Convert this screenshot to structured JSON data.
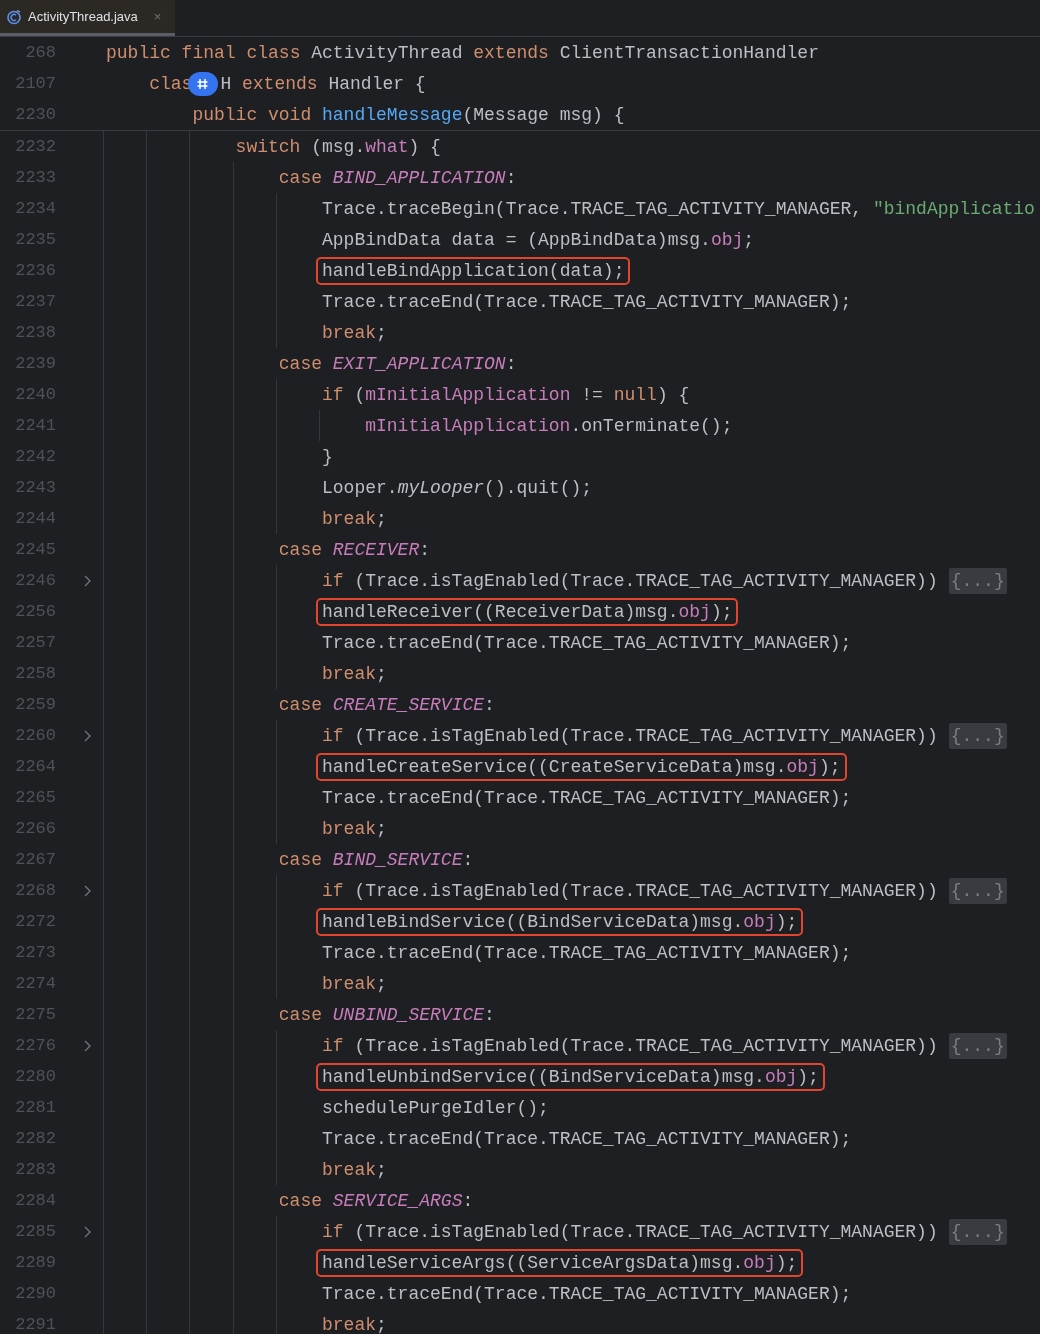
{
  "tabs": [
    {
      "label": "ActivityThread.java",
      "close": "×",
      "selected": true
    }
  ],
  "sticky_header": [
    {
      "number": "268",
      "tokens": [
        {
          "kind": "kw",
          "text": "public final class "
        },
        {
          "kind": "plain",
          "text": "ActivityThread "
        },
        {
          "kind": "kw",
          "text": "extends "
        },
        {
          "kind": "plain",
          "text": "ClientTransactionHandler"
        }
      ],
      "children": [
        {
          "number": "2107",
          "tokens": [
            {
              "kind": "kw",
              "text": "clas"
            },
            {
              "kind": "badge"
            },
            {
              "kind": "plain",
              "text": "H "
            },
            {
              "kind": "kw",
              "text": "extends "
            },
            {
              "kind": "plain",
              "text": "Handler {"
            }
          ],
          "children": [
            {
              "number": "2230",
              "tokens": [
                {
                  "kind": "kw",
                  "text": "public void "
                },
                {
                  "kind": "decl",
                  "text": "handleMessage"
                },
                {
                  "kind": "plain",
                  "text": "(Message msg) {"
                }
              ]
            }
          ]
        }
      ]
    }
  ],
  "code": [
    {
      "number": "2232",
      "collapsed": false,
      "boxed": false,
      "tokens": [
        {
          "kind": "kw",
          "text": "switch "
        },
        {
          "kind": "plain",
          "text": "(msg."
        },
        {
          "kind": "field",
          "text": "what"
        },
        {
          "kind": "plain",
          "text": ") {"
        }
      ],
      "children": [
        {
          "number": "2233",
          "collapsed": false,
          "boxed": false,
          "tokens": [
            {
              "kind": "kw",
              "text": "case "
            },
            {
              "kind": "const",
              "text": "BIND_APPLICATION"
            },
            {
              "kind": "plain",
              "text": ":"
            }
          ],
          "children": [
            {
              "number": "2234",
              "collapsed": false,
              "boxed": false,
              "tokens": [
                {
                  "kind": "plain",
                  "text": "Trace.traceBegin(Trace.TRACE_TAG_ACTIVITY_MANAGER, "
                },
                {
                  "kind": "str",
                  "text": "\"bindApplicatio"
                }
              ]
            },
            {
              "number": "2235",
              "collapsed": false,
              "boxed": false,
              "tokens": [
                {
                  "kind": "plain",
                  "text": "AppBindData data = (AppBindData)msg."
                },
                {
                  "kind": "field",
                  "text": "obj"
                },
                {
                  "kind": "plain",
                  "text": ";"
                }
              ]
            },
            {
              "number": "2236",
              "collapsed": false,
              "boxed": true,
              "tokens": [
                {
                  "kind": "plain",
                  "text": "handleBindApplication(data);"
                }
              ]
            },
            {
              "number": "2237",
              "collapsed": false,
              "boxed": false,
              "tokens": [
                {
                  "kind": "plain",
                  "text": "Trace.traceEnd(Trace.TRACE_TAG_ACTIVITY_MANAGER);"
                }
              ]
            },
            {
              "number": "2238",
              "collapsed": false,
              "boxed": false,
              "tokens": [
                {
                  "kind": "kw",
                  "text": "break"
                },
                {
                  "kind": "plain",
                  "text": ";"
                }
              ]
            }
          ]
        },
        {
          "number": "2239",
          "collapsed": false,
          "boxed": false,
          "tokens": [
            {
              "kind": "kw",
              "text": "case "
            },
            {
              "kind": "const",
              "text": "EXIT_APPLICATION"
            },
            {
              "kind": "plain",
              "text": ":"
            }
          ],
          "children": [
            {
              "number": "2240",
              "collapsed": false,
              "boxed": false,
              "tokens": [
                {
                  "kind": "kw",
                  "text": "if "
                },
                {
                  "kind": "plain",
                  "text": "("
                },
                {
                  "kind": "field",
                  "text": "mInitialApplication"
                },
                {
                  "kind": "plain",
                  "text": " != "
                },
                {
                  "kind": "kw",
                  "text": "null"
                },
                {
                  "kind": "plain",
                  "text": ") {"
                }
              ],
              "children": [
                {
                  "number": "2241",
                  "collapsed": false,
                  "boxed": false,
                  "tokens": [
                    {
                      "kind": "field",
                      "text": "mInitialApplication"
                    },
                    {
                      "kind": "plain",
                      "text": ".onTerminate();"
                    }
                  ]
                }
              ]
            },
            {
              "number": "2242",
              "collapsed": false,
              "boxed": false,
              "tokens": [
                {
                  "kind": "plain",
                  "text": "}"
                }
              ]
            },
            {
              "number": "2243",
              "collapsed": false,
              "boxed": false,
              "tokens": [
                {
                  "kind": "plain",
                  "text": "Looper."
                },
                {
                  "kind": "static",
                  "text": "myLooper"
                },
                {
                  "kind": "plain",
                  "text": "().quit();"
                }
              ]
            },
            {
              "number": "2244",
              "collapsed": false,
              "boxed": false,
              "tokens": [
                {
                  "kind": "kw",
                  "text": "break"
                },
                {
                  "kind": "plain",
                  "text": ";"
                }
              ]
            }
          ]
        },
        {
          "number": "2245",
          "collapsed": false,
          "boxed": false,
          "tokens": [
            {
              "kind": "kw",
              "text": "case "
            },
            {
              "kind": "const",
              "text": "RECEIVER"
            },
            {
              "kind": "plain",
              "text": ":"
            }
          ],
          "children": [
            {
              "number": "2246",
              "collapsed": true,
              "boxed": false,
              "tokens": [
                {
                  "kind": "kw",
                  "text": "if "
                },
                {
                  "kind": "plain",
                  "text": "(Trace.isTagEnabled(Trace.TRACE_TAG_ACTIVITY_MANAGER))"
                },
                {
                  "kind": "fold",
                  "text": "{...}"
                }
              ]
            },
            {
              "number": "2256",
              "collapsed": false,
              "boxed": true,
              "tokens": [
                {
                  "kind": "plain",
                  "text": "handleReceiver((ReceiverData)msg."
                },
                {
                  "kind": "field",
                  "text": "obj"
                },
                {
                  "kind": "plain",
                  "text": ");"
                }
              ]
            },
            {
              "number": "2257",
              "collapsed": false,
              "boxed": false,
              "tokens": [
                {
                  "kind": "plain",
                  "text": "Trace.traceEnd(Trace.TRACE_TAG_ACTIVITY_MANAGER);"
                }
              ]
            },
            {
              "number": "2258",
              "collapsed": false,
              "boxed": false,
              "tokens": [
                {
                  "kind": "kw",
                  "text": "break"
                },
                {
                  "kind": "plain",
                  "text": ";"
                }
              ]
            }
          ]
        },
        {
          "number": "2259",
          "collapsed": false,
          "boxed": false,
          "tokens": [
            {
              "kind": "kw",
              "text": "case "
            },
            {
              "kind": "const",
              "text": "CREATE_SERVICE"
            },
            {
              "kind": "plain",
              "text": ":"
            }
          ],
          "children": [
            {
              "number": "2260",
              "collapsed": true,
              "boxed": false,
              "tokens": [
                {
                  "kind": "kw",
                  "text": "if "
                },
                {
                  "kind": "plain",
                  "text": "(Trace.isTagEnabled(Trace.TRACE_TAG_ACTIVITY_MANAGER))"
                },
                {
                  "kind": "fold",
                  "text": "{...}"
                }
              ]
            },
            {
              "number": "2264",
              "collapsed": false,
              "boxed": true,
              "tokens": [
                {
                  "kind": "plain",
                  "text": "handleCreateService((CreateServiceData)msg."
                },
                {
                  "kind": "field",
                  "text": "obj"
                },
                {
                  "kind": "plain",
                  "text": ");"
                }
              ]
            },
            {
              "number": "2265",
              "collapsed": false,
              "boxed": false,
              "tokens": [
                {
                  "kind": "plain",
                  "text": "Trace.traceEnd(Trace.TRACE_TAG_ACTIVITY_MANAGER);"
                }
              ]
            },
            {
              "number": "2266",
              "collapsed": false,
              "boxed": false,
              "tokens": [
                {
                  "kind": "kw",
                  "text": "break"
                },
                {
                  "kind": "plain",
                  "text": ";"
                }
              ]
            }
          ]
        },
        {
          "number": "2267",
          "collapsed": false,
          "boxed": false,
          "tokens": [
            {
              "kind": "kw",
              "text": "case "
            },
            {
              "kind": "const",
              "text": "BIND_SERVICE"
            },
            {
              "kind": "plain",
              "text": ":"
            }
          ],
          "children": [
            {
              "number": "2268",
              "collapsed": true,
              "boxed": false,
              "tokens": [
                {
                  "kind": "kw",
                  "text": "if "
                },
                {
                  "kind": "plain",
                  "text": "(Trace.isTagEnabled(Trace.TRACE_TAG_ACTIVITY_MANAGER))"
                },
                {
                  "kind": "fold",
                  "text": "{...}"
                }
              ]
            },
            {
              "number": "2272",
              "collapsed": false,
              "boxed": true,
              "tokens": [
                {
                  "kind": "plain",
                  "text": "handleBindService((BindServiceData)msg."
                },
                {
                  "kind": "field",
                  "text": "obj"
                },
                {
                  "kind": "plain",
                  "text": ");"
                }
              ]
            },
            {
              "number": "2273",
              "collapsed": false,
              "boxed": false,
              "tokens": [
                {
                  "kind": "plain",
                  "text": "Trace.traceEnd(Trace.TRACE_TAG_ACTIVITY_MANAGER);"
                }
              ]
            },
            {
              "number": "2274",
              "collapsed": false,
              "boxed": false,
              "tokens": [
                {
                  "kind": "kw",
                  "text": "break"
                },
                {
                  "kind": "plain",
                  "text": ";"
                }
              ]
            }
          ]
        },
        {
          "number": "2275",
          "collapsed": false,
          "boxed": false,
          "tokens": [
            {
              "kind": "kw",
              "text": "case "
            },
            {
              "kind": "const",
              "text": "UNBIND_SERVICE"
            },
            {
              "kind": "plain",
              "text": ":"
            }
          ],
          "children": [
            {
              "number": "2276",
              "collapsed": true,
              "boxed": false,
              "tokens": [
                {
                  "kind": "kw",
                  "text": "if "
                },
                {
                  "kind": "plain",
                  "text": "(Trace.isTagEnabled(Trace.TRACE_TAG_ACTIVITY_MANAGER))"
                },
                {
                  "kind": "fold",
                  "text": "{...}"
                }
              ]
            },
            {
              "number": "2280",
              "collapsed": false,
              "boxed": true,
              "tokens": [
                {
                  "kind": "plain",
                  "text": "handleUnbindService((BindServiceData)msg."
                },
                {
                  "kind": "field",
                  "text": "obj"
                },
                {
                  "kind": "plain",
                  "text": ");"
                }
              ]
            },
            {
              "number": "2281",
              "collapsed": false,
              "boxed": false,
              "tokens": [
                {
                  "kind": "plain",
                  "text": "schedulePurgeIdler();"
                }
              ]
            },
            {
              "number": "2282",
              "collapsed": false,
              "boxed": false,
              "tokens": [
                {
                  "kind": "plain",
                  "text": "Trace.traceEnd(Trace.TRACE_TAG_ACTIVITY_MANAGER);"
                }
              ]
            },
            {
              "number": "2283",
              "collapsed": false,
              "boxed": false,
              "tokens": [
                {
                  "kind": "kw",
                  "text": "break"
                },
                {
                  "kind": "plain",
                  "text": ";"
                }
              ]
            }
          ]
        },
        {
          "number": "2284",
          "collapsed": false,
          "boxed": false,
          "tokens": [
            {
              "kind": "kw",
              "text": "case "
            },
            {
              "kind": "const",
              "text": "SERVICE_ARGS"
            },
            {
              "kind": "plain",
              "text": ":"
            }
          ],
          "children": [
            {
              "number": "2285",
              "collapsed": true,
              "boxed": false,
              "tokens": [
                {
                  "kind": "kw",
                  "text": "if "
                },
                {
                  "kind": "plain",
                  "text": "(Trace.isTagEnabled(Trace.TRACE_TAG_ACTIVITY_MANAGER))"
                },
                {
                  "kind": "fold",
                  "text": "{...}"
                }
              ]
            },
            {
              "number": "2289",
              "collapsed": false,
              "boxed": true,
              "tokens": [
                {
                  "kind": "plain",
                  "text": "handleServiceArgs((ServiceArgsData)msg."
                },
                {
                  "kind": "field",
                  "text": "obj"
                },
                {
                  "kind": "plain",
                  "text": ");"
                }
              ]
            },
            {
              "number": "2290",
              "collapsed": false,
              "boxed": false,
              "tokens": [
                {
                  "kind": "plain",
                  "text": "Trace.traceEnd(Trace.TRACE_TAG_ACTIVITY_MANAGER);"
                }
              ]
            },
            {
              "number": "2291",
              "collapsed": false,
              "boxed": false,
              "tokens": [
                {
                  "kind": "kw",
                  "text": "break"
                },
                {
                  "kind": "plain",
                  "text": ";"
                }
              ]
            }
          ]
        }
      ]
    }
  ]
}
